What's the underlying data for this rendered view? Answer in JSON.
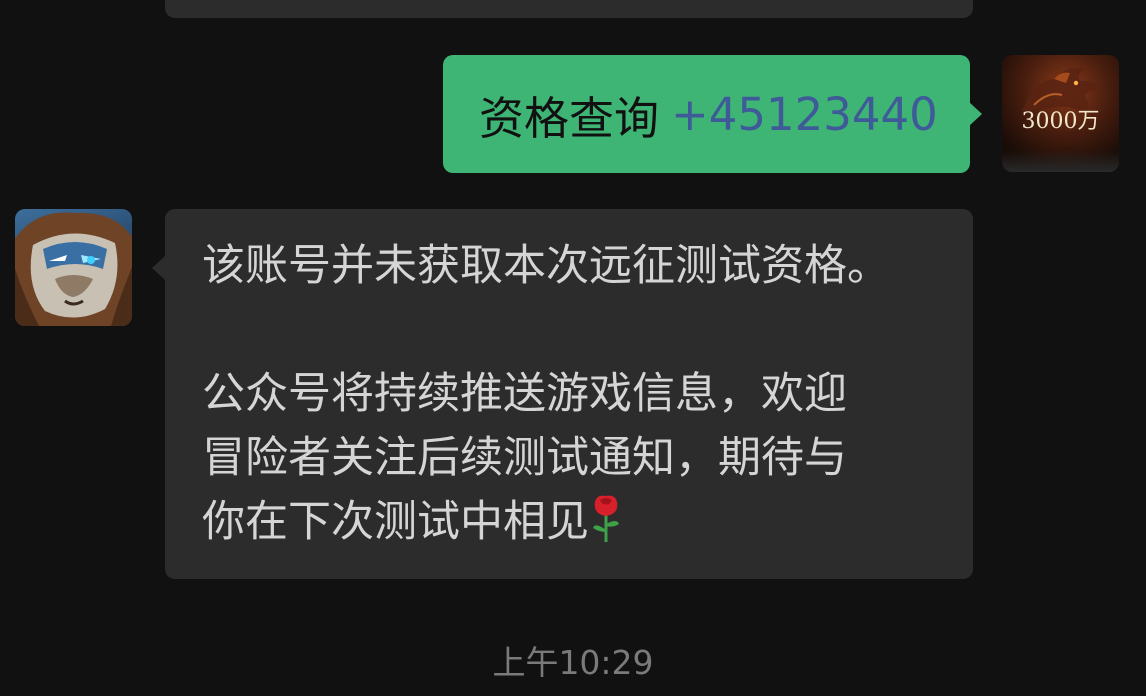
{
  "messages": {
    "outgoing": {
      "text": "资格查询",
      "phone": "+45123440"
    },
    "incoming": {
      "line1": "该账号并未获取本次远征测试资格。",
      "line2": "公众号将持续推送游戏信息，欢迎",
      "line3": "冒险者关注后续测试通知，期待与",
      "line4": "你在下次测试中相见"
    },
    "timestamp": "上午10:29"
  },
  "avatars": {
    "self": {
      "count": "3000万",
      "icon": "dragon-game-avatar"
    },
    "bot": {
      "icon": "lion-warrior-avatar"
    }
  },
  "icons": {
    "rose": "rose-emoji"
  },
  "colors": {
    "background": "#111111",
    "outgoing_bubble": "#3eb575",
    "incoming_bubble": "#2c2c2c",
    "phone_link": "#3f5a98"
  }
}
